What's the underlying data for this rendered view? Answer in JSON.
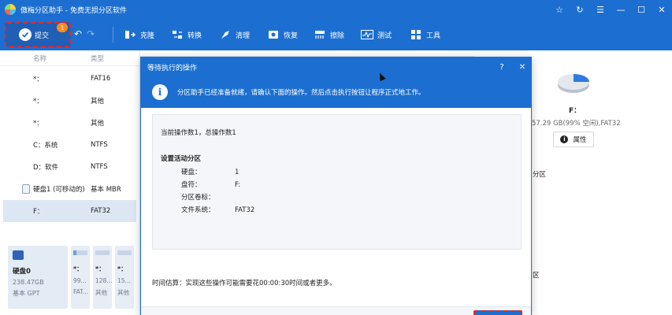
{
  "window": {
    "title": "傲梅分区助手 - 免费无损分区软件",
    "controls": [
      "☆",
      "↻",
      "☰",
      "—",
      "☐",
      "✕"
    ]
  },
  "toolbar": {
    "commit_label": "提交",
    "commit_badge": "1",
    "undo": "↶",
    "redo": "↷",
    "tools": [
      {
        "label": "克隆",
        "icon": "clone-icon"
      },
      {
        "label": "转换",
        "icon": "convert-icon"
      },
      {
        "label": "清理",
        "icon": "clean-icon"
      },
      {
        "label": "恢复",
        "icon": "recover-icon"
      },
      {
        "label": "擦除",
        "icon": "wipe-icon"
      },
      {
        "label": "测试",
        "icon": "test-icon"
      },
      {
        "label": "工具",
        "icon": "tools-icon"
      }
    ]
  },
  "partition_list": {
    "headers": {
      "name": "名称",
      "type": "类型"
    },
    "rows": [
      {
        "name": "*：",
        "type": "FAT16"
      },
      {
        "name": "*：",
        "type": "其他"
      },
      {
        "name": "*：",
        "type": "其他"
      },
      {
        "name": "C：系统",
        "type": "NTFS"
      },
      {
        "name": "D：软件",
        "type": "NTFS"
      },
      {
        "name": "硬盘1 (可移动的)",
        "type": "基本 MBR",
        "is_disk": true
      },
      {
        "name": "F：",
        "type": "FAT32",
        "selected": true
      }
    ]
  },
  "disk_map": {
    "disk": {
      "name": "硬盘0",
      "size": "238.47GB",
      "type": "基本 GPT"
    },
    "partitions": [
      {
        "l1": "*：",
        "l2": "99...",
        "l3": "FAT...",
        "fill": 0.2
      },
      {
        "l1": "*：",
        "l2": "128...",
        "l3": "其他",
        "fill": 0.0
      },
      {
        "l1": "*：",
        "l2": "15...",
        "l3": "其他",
        "fill": 0.0
      }
    ]
  },
  "right_panel": {
    "drive_label": "F：",
    "size_text": "57.29 GB(99% 空闲),FAT32",
    "properties_label": "属性",
    "frag1": "分区",
    "frag2": "区"
  },
  "dialog": {
    "title": "等待执行的操作",
    "help": "?",
    "close": "✕",
    "info_text": "分区助手已经准备就绪，请确认下面的操作。然后点击执行按钮让程序正式地工作。",
    "current_ops": "当前操作数1，总操作数1",
    "op_name": "设置活动分区",
    "details": [
      {
        "key": "硬盘：",
        "value": "1"
      },
      {
        "key": "盘符：",
        "value": "F:"
      },
      {
        "key": "分区卷标：",
        "value": ""
      },
      {
        "key": "文件系统：",
        "value": "FAT32"
      }
    ],
    "time_estimate": "时间估算：实现这些操作可能需要花00:00:30时间或者更多。"
  }
}
